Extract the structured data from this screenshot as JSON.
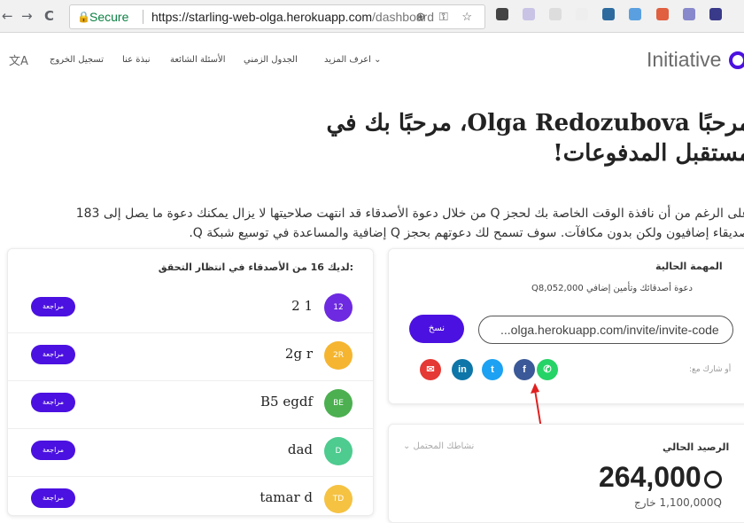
{
  "browser": {
    "secure_label": "Secure",
    "url_host": "https://starling-web-olga.herokuapp.com",
    "url_path": "/dashboard",
    "omnibox_icons": "⊕ ⚿ ☆",
    "back": "←",
    "forward": "→",
    "reload": "C"
  },
  "header": {
    "logo_text": "Initiative",
    "translate_icon": "文A",
    "nav": [
      "تسجيل الخروج",
      "نبذة عنا",
      "الأسئلة الشائعة",
      "الجدول الزمني",
      "اعرف المزيد ⌄"
    ]
  },
  "hero": {
    "title": "مرحبًا Olga Redozubova، مرحبًا بك في مستقبل المدفوعات!",
    "description": "على الرغم من أن نافذة الوقت الخاصة بك لحجز Q من خلال دعوة الأصدقاء قد انتهت صلاحيتها لا يزال يمكنك دعوة ما يصل إلى 183 صديقاء إضافيون ولكن بدون مكافآت. سوف تسمح لك دعوتهم بحجز Q إضافية والمساعدة في توسيع شبكة Q."
  },
  "pending": {
    "title": "لديك 16 من الأصدقاء في انتظار التحقق:",
    "review_label": "مراجعة",
    "rows": [
      {
        "name": "2 1",
        "avatar": "12",
        "color": "#6d2ae0"
      },
      {
        "name": "2g r",
        "avatar": "2R",
        "color": "#f5b530"
      },
      {
        "name": "B5 egdf",
        "avatar": "BE",
        "color": "#4caf50"
      },
      {
        "name": "dad",
        "avatar": "D",
        "color": "#4ecb8f"
      },
      {
        "name": "tamar d",
        "avatar": "TD",
        "color": "#f5c242"
      }
    ]
  },
  "mission": {
    "title": "المهمة الحالية",
    "text": "دعوة أصدقائك وتأمين إضافي Q8,052,000",
    "copy_label": "نسخ",
    "invite_value": "...olga.herokuapp.com/invite/invite-code",
    "share_label": "أو شارك مع:"
  },
  "balance": {
    "title": "الرصيد الحالي",
    "potential": "نشاطك المحتمل ⌄",
    "amount": "264,000",
    "sub": "1,100,000Q خارج"
  },
  "share_icons": [
    {
      "name": "email-icon",
      "color": "#e53935",
      "glyph": "✉"
    },
    {
      "name": "linkedin-icon",
      "color": "#0e76a8",
      "glyph": "in"
    },
    {
      "name": "twitter-icon",
      "color": "#1da1f2",
      "glyph": "t"
    },
    {
      "name": "facebook-icon",
      "color": "#3b5998",
      "glyph": "f"
    },
    {
      "name": "whatsapp-icon",
      "color": "#25d366",
      "glyph": "✆"
    }
  ],
  "colors": {
    "accent": "#4b11e0",
    "annotation": "#e02020"
  }
}
